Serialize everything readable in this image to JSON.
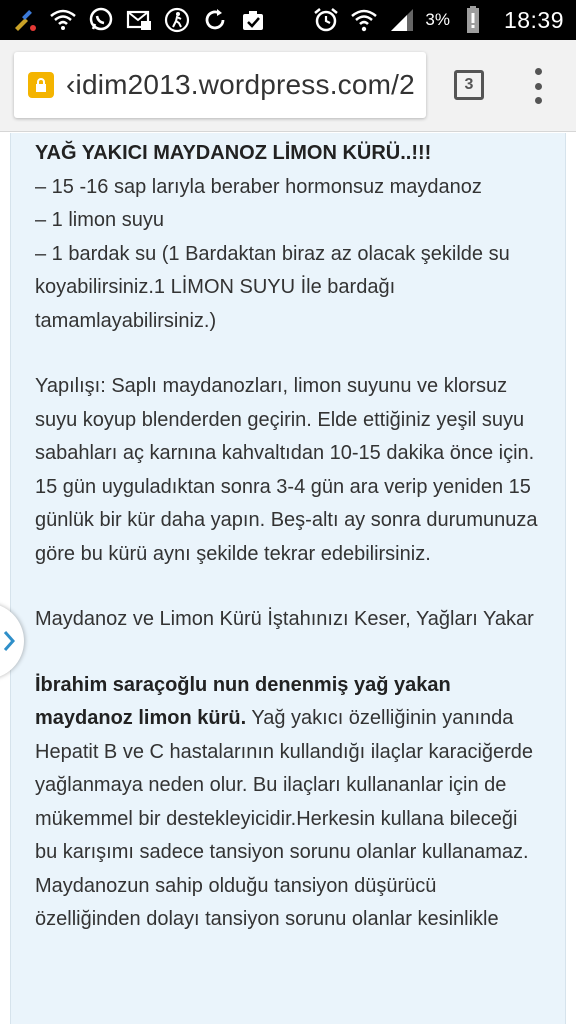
{
  "status_bar": {
    "battery_percent": "3%",
    "time": "18:39"
  },
  "browser": {
    "url": "‹idim2013.wordpress.com/2",
    "tab_count": "3"
  },
  "article": {
    "title": "YAĞ YAKICI MAYDANOZ LİMON KÜRÜ..!!!",
    "ingredients": [
      "– 15 -16 sap larıyla beraber hormonsuz maydanoz",
      "– 1 limon suyu",
      "– 1 bardak su (1 Bardaktan biraz az olacak şekilde su koyabilirsiniz.1 LİMON SUYU İle bardağı tamamlayabilirsiniz.)"
    ],
    "preparation": "Yapılışı: Saplı maydanozları, limon suyunu ve klorsuz suyu koyup blenderden geçirin. Elde ettiğiniz yeşil suyu sabahları aç karnına kahvaltıdan 10-15 dakika önce için. 15 gün uyguladıktan sonra 3-4 gün ara verip yeniden 15 günlük bir kür daha yapın. Beş-altı ay sonra durumunuza göre bu kürü aynı şekilde tekrar edebilirsiniz.",
    "subheading": "Maydanoz ve Limon Kürü İştahınızı Keser, Yağları Yakar",
    "bold_lead": "İbrahim saraçoğlu nun denenmiş yağ yakan maydanoz limon kürü.",
    "body": " Yağ yakıcı özelliğinin yanında Hepatit B ve C hastalarının kullandığı ilaçlar karaciğerde yağlanmaya neden olur. Bu ilaçları kullananlar için de mükemmel bir destekleyicidir.Herkesin kullana bileceği bu karışımı sadece tansiyon sorunu olanlar kullanamaz. Maydanozun sahip olduğu tansiyon düşürücü özelliğinden dolayı tansiyon sorunu olanlar kesinlikle"
  }
}
